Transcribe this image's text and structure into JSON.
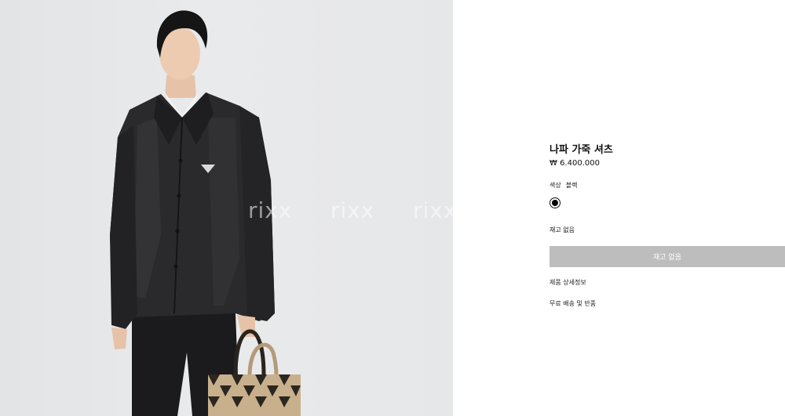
{
  "watermarks": [
    "rixx",
    "rixx",
    "rixx"
  ],
  "product": {
    "title": "나파 가죽 셔츠",
    "price": "₩ 6.400.000",
    "color_label": "색상",
    "color_value": "블랙",
    "swatch_color": "#000000",
    "stock_text": "재고 없음",
    "cta_label": "재고 없음",
    "cta_color": "#bdbdbd"
  },
  "links": {
    "details": "제품 상세정보",
    "shipping": "무료 배송 및 반품"
  }
}
